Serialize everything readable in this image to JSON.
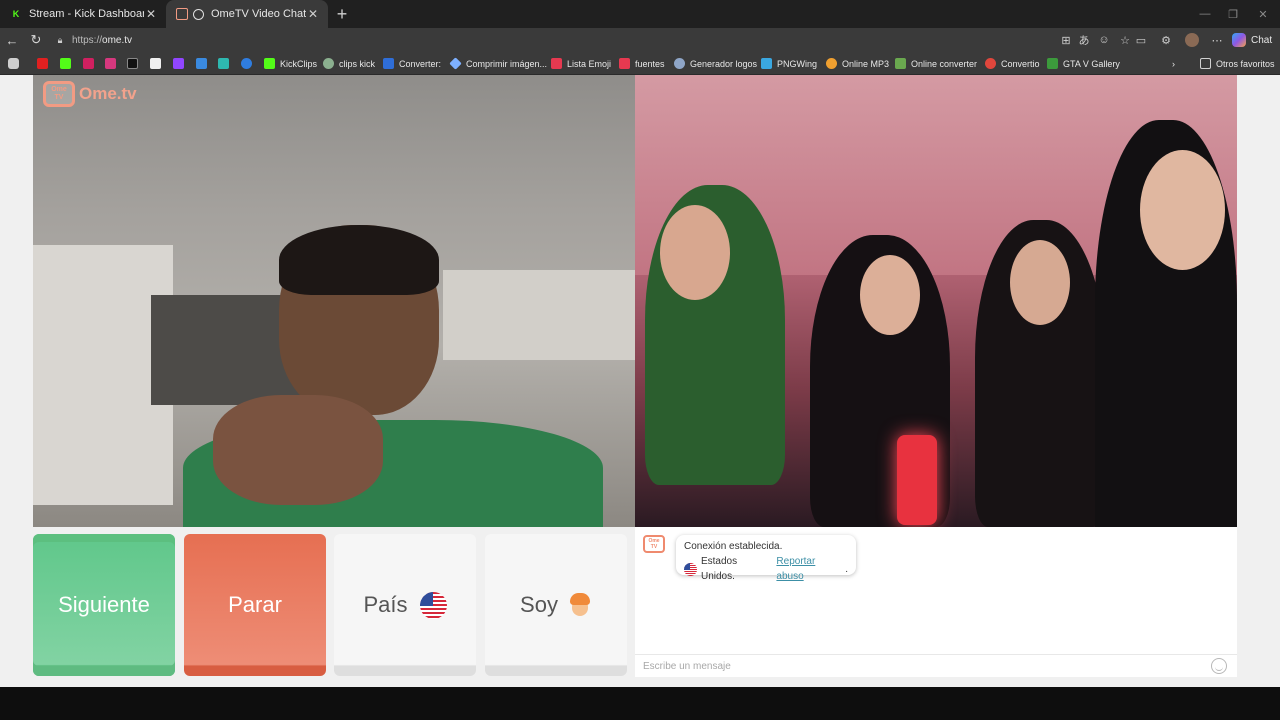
{
  "browser": {
    "tabs": [
      {
        "title": "Stream - Kick Dashboard",
        "active": false,
        "favicon": "kick-icon"
      },
      {
        "title": "OmeTV Video Chat — Omegle",
        "active": true,
        "favicon": "ometv-icon"
      }
    ],
    "url_protocol": "https://",
    "url_host": "ome.tv",
    "chat_label": "Chat",
    "bookmarks": [
      {
        "label": "KickClips",
        "color": "#53fc18"
      },
      {
        "label": "clips kick",
        "color": "#8bb08f"
      },
      {
        "label": "Converter:",
        "color": "#2f6ed8"
      },
      {
        "label": "Comprimir imágen...",
        "color": "#7db0ff"
      },
      {
        "label": "Lista Emoji",
        "color": "#e63950"
      },
      {
        "label": "fuentes",
        "color": "#e63950"
      },
      {
        "label": "Generador logos",
        "color": "#8fa6c8"
      },
      {
        "label": "PNGWing",
        "color": "#3aa7e0"
      },
      {
        "label": "Online MP3",
        "color": "#f0a030"
      },
      {
        "label": "Online converter",
        "color": "#6aa84f"
      },
      {
        "label": "Convertio",
        "color": "#e0463c"
      },
      {
        "label": "GTA V Gallery",
        "color": "#3c9a3c"
      }
    ],
    "other_favorites": "Otros favoritos"
  },
  "app": {
    "logo_small": "Ome TV",
    "logo_word": "Ome.tv"
  },
  "controls": {
    "next_label": "Siguiente",
    "stop_label": "Parar",
    "country_label": "País",
    "gender_label": "Soy"
  },
  "chat": {
    "status_line1": "Conexión establecida.",
    "country_text": "Estados Unidos.",
    "report_link": "Reportar abuso",
    "report_suffix": ".",
    "input_placeholder": "Escribe un mensaje"
  },
  "colors": {
    "next_green": "#6fcb95",
    "stop_red": "#eb7f64",
    "accent_link": "#3c8fa6"
  }
}
